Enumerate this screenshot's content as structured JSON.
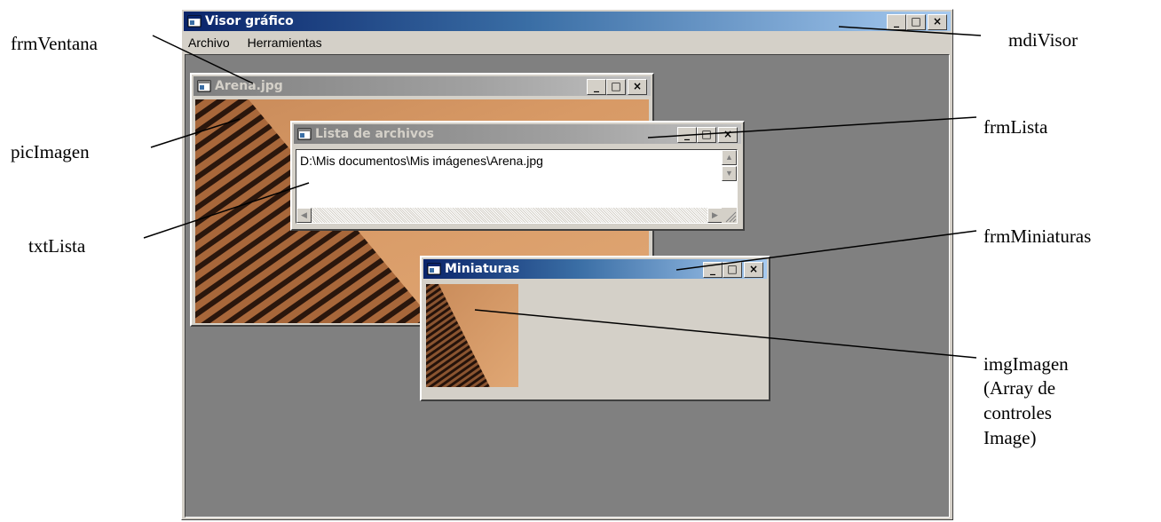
{
  "mdi": {
    "title": "Visor gráfico",
    "menu": [
      "Archivo",
      "Herramientas"
    ]
  },
  "frm_ventana": {
    "title": "Arena.jpg"
  },
  "frm_lista": {
    "title": "Lista de archivos",
    "text": "D:\\Mis documentos\\Mis imágenes\\Arena.jpg"
  },
  "frm_miniaturas": {
    "title": "Miniaturas"
  },
  "window_buttons": {
    "minimize": "_",
    "maximize": "□",
    "close": "×"
  },
  "callouts": {
    "frmVentana": "frmVentana",
    "picImagen": "picImagen",
    "txtLista": "txtLista",
    "mdiVisor": "mdiVisor",
    "frmLista": "frmLista",
    "frmMiniaturas": "frmMiniaturas",
    "imgImagen_1": "imgImagen",
    "imgImagen_2": "(Array de",
    "imgImagen_3": "controles",
    "imgImagen_4": "Image)"
  },
  "colors": {
    "active_title": "#0a246a",
    "inactive_title": "#808080",
    "face": "#d4d0c8",
    "mdi_client": "#808080"
  }
}
